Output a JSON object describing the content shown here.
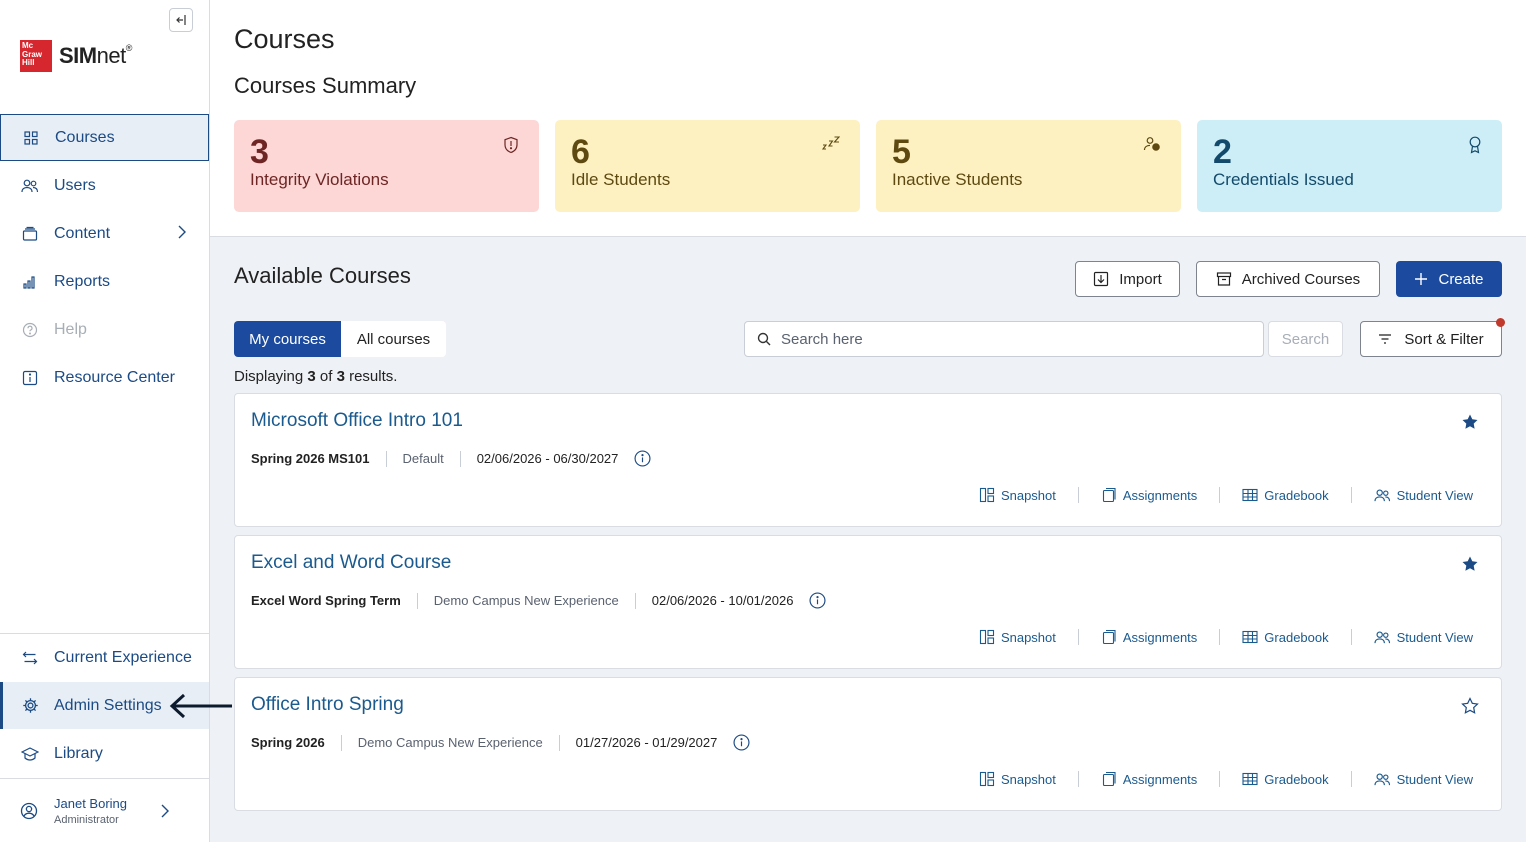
{
  "sidebar": {
    "logo": {
      "box_text": "Mc Graw Hill",
      "brand_bold": "SIM",
      "brand_light": "net",
      "tm": "®"
    },
    "nav": [
      {
        "label": "Courses",
        "icon": "grid-icon"
      },
      {
        "label": "Users",
        "icon": "users-icon"
      },
      {
        "label": "Content",
        "icon": "stack-icon"
      },
      {
        "label": "Reports",
        "icon": "bar-chart-icon"
      },
      {
        "label": "Help",
        "icon": "question-icon"
      },
      {
        "label": "Resource Center",
        "icon": "info-icon"
      }
    ],
    "bottom_nav": [
      {
        "label": "Current Experience",
        "icon": "swap-icon"
      },
      {
        "label": "Admin Settings",
        "icon": "gear-icon"
      },
      {
        "label": "Library",
        "icon": "graduation-cap-icon"
      }
    ],
    "user": {
      "name": "Janet Boring",
      "role": "Administrator"
    }
  },
  "main": {
    "title": "Courses",
    "summary_title": "Courses Summary",
    "summary_cards": [
      {
        "value": "3",
        "label": "Integrity Violations",
        "icon": "shield-alert-icon",
        "bg": "#fcd7d6",
        "fg": "#6e2624"
      },
      {
        "value": "6",
        "label": "Idle Students",
        "icon": "sleep-zzz-icon",
        "bg": "#fdf1c2",
        "fg": "#5e4a10"
      },
      {
        "value": "5",
        "label": "Inactive Students",
        "icon": "user-clock-icon",
        "bg": "#fdf1c2",
        "fg": "#5e4a10"
      },
      {
        "value": "2",
        "label": "Credentials Issued",
        "icon": "award-icon",
        "bg": "#cdeef7",
        "fg": "#134a6b"
      }
    ],
    "available_title": "Available Courses",
    "buttons": {
      "import": "Import",
      "archived": "Archived Courses",
      "create": "Create"
    },
    "tabs": {
      "mine": "My courses",
      "all": "All courses"
    },
    "search": {
      "placeholder": "Search here",
      "button": "Search"
    },
    "sort_filter": "Sort & Filter",
    "results": {
      "prefix": "Displaying ",
      "shown": "3",
      "mid": " of ",
      "total": "3",
      "suffix": " results."
    },
    "courses": [
      {
        "title": "Microsoft Office Intro 101",
        "code": "Spring 2026 MS101",
        "campus": "Default",
        "dates": "02/06/2026 - 06/30/2027",
        "starred": true
      },
      {
        "title": "Excel and Word Course",
        "code": "Excel Word Spring Term",
        "campus": "Demo Campus New Experience",
        "dates": "02/06/2026 - 10/01/2026",
        "starred": true
      },
      {
        "title": "Office Intro Spring",
        "code": "Spring 2026",
        "campus": "Demo Campus New Experience",
        "dates": "01/27/2026 - 01/29/2027",
        "starred": false
      }
    ],
    "course_links": {
      "snapshot": "Snapshot",
      "assignments": "Assignments",
      "gradebook": "Gradebook",
      "student_view": "Student View"
    }
  },
  "colors": {
    "primary": "#1b4a9e",
    "link": "#1b5a8e",
    "nav": "#1b4a84"
  }
}
